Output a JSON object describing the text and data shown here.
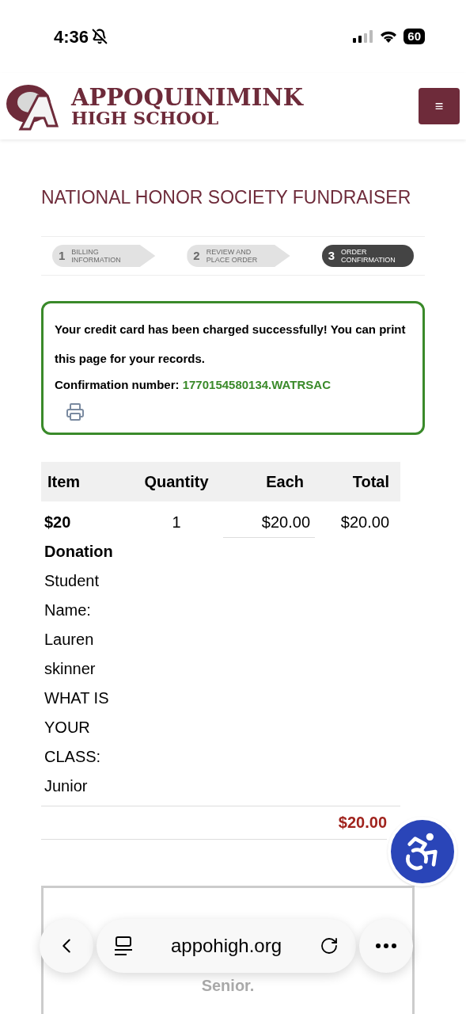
{
  "status_bar": {
    "time": "4:36",
    "battery": "60"
  },
  "header": {
    "school_name": "APPOQUINIMINK",
    "school_subtitle": "HIGH SCHOOL",
    "menu_icon": "≡"
  },
  "title": "NATIONAL HONOR SOCIETY FUNDRAISER",
  "steps": [
    {
      "number": "1",
      "label": "BILLING INFORMATION",
      "selected": false
    },
    {
      "number": "2",
      "label": "REVIEW AND PLACE ORDER",
      "selected": false
    },
    {
      "number": "3",
      "label": "ORDER CONFIRMATION",
      "selected": true
    }
  ],
  "success": {
    "message": "Your credit card has been charged successfully! You can print this page for your records.",
    "confirmation_label": "Confirmation number:",
    "confirmation_number": "1770154580134.WATRSAC"
  },
  "table": {
    "columns": [
      "Item",
      "Quantity",
      "Each",
      "Total"
    ],
    "rows": [
      {
        "item": "$20 Donation",
        "details": "Student Name: Lauren skinner WHAT IS YOUR CLASS: Junior",
        "quantity": "1",
        "each": "$20.00",
        "total": "$20.00"
      }
    ],
    "grand_total": "$20.00"
  },
  "notice": {
    "text": "Senior."
  },
  "browser_bar": {
    "url": "appohigh.org"
  }
}
